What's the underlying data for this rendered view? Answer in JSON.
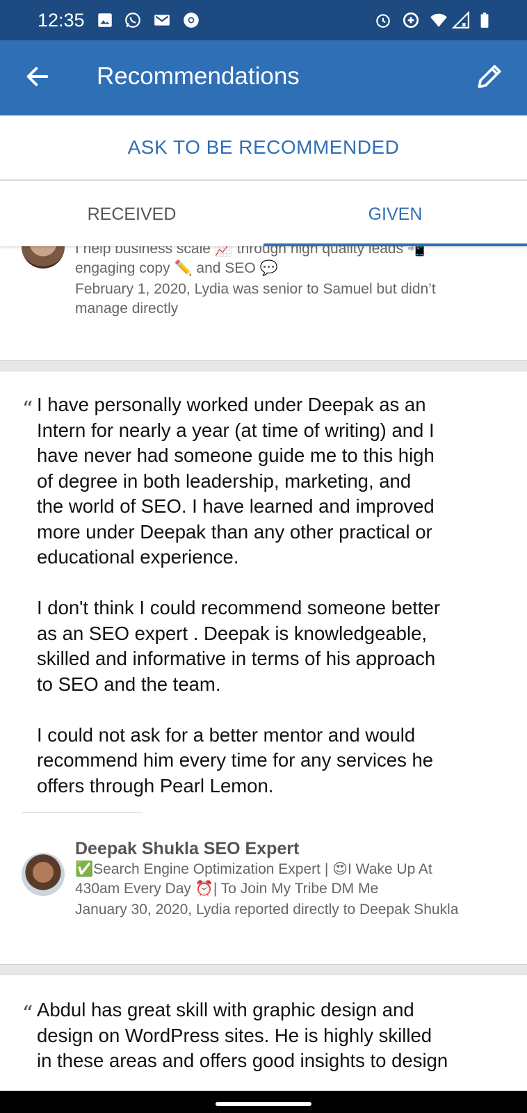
{
  "status_bar": {
    "time": "12:35",
    "left_icons": [
      "gallery-icon",
      "whatsapp-icon",
      "gmail-icon",
      "chrome-icon"
    ],
    "right_icons": [
      "alarm-icon",
      "data-saver-icon",
      "wifi-icon",
      "signal-icon",
      "battery-icon"
    ]
  },
  "app_bar": {
    "title": "Recommendations",
    "back_icon": "arrow-back-icon",
    "edit_icon": "pencil-icon"
  },
  "ask_button": "ASK TO BE RECOMMENDED",
  "tabs": [
    {
      "label": "RECEIVED",
      "selected": false
    },
    {
      "label": "GIVEN",
      "selected": true
    }
  ],
  "recommendations": [
    {
      "headline": "I help business scale 📈 through high quality leads 📲 engaging copy ✏️ and SEO 💬",
      "headline_line1": "I help business scale 📈 through high quality leads 📲",
      "headline_line2": "engaging copy ✏️ and SEO 💬",
      "meta_line1": "February 1, 2020, Lydia was senior to Samuel but didn’t",
      "meta_line2": "manage directly"
    },
    {
      "quote_mark": "“",
      "text": "I have personally worked under Deepak as an\nIntern for nearly a year (at time of writing) and I\nhave never had someone guide me to this high\nof degree in both leadership, marketing, and\nthe world of SEO. I have learned and improved\nmore under Deepak than any other practical or\neducational experience.\n\nI don't think I could recommend someone better\nas an SEO expert . Deepak is knowledgeable,\nskilled and informative in terms of his approach\nto SEO and the team.\n\nI could not ask for a better mentor and would\nrecommend him every time for any services he\noffers through Pearl Lemon.",
      "name": "Deepak Shukla SEO Expert",
      "headline_line1": "✅Search Engine Optimization Expert | 😍I Wake Up At",
      "headline_line2": "430am Every Day ⏰| To Join My Tribe DM Me",
      "meta": "January 30, 2020, Lydia reported directly to Deepak Shukla"
    },
    {
      "quote_mark": "“",
      "text": "Abdul has great skill with graphic design and\ndesign on WordPress sites. He is highly skilled\nin these areas and offers good insights to design"
    }
  ],
  "colors": {
    "status_bar": "#1d4a80",
    "app_bar": "#2f6fb6",
    "accent": "#2f6fb6",
    "divider": "#e7e7e7"
  }
}
